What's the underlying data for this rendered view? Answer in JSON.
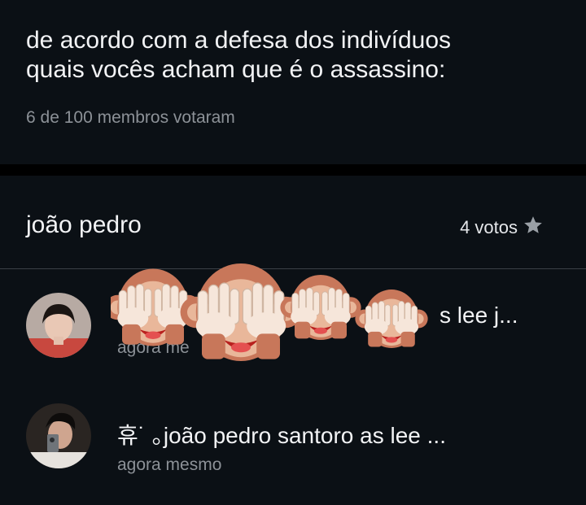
{
  "poll": {
    "question_line1": "de acordo com a defesa dos indivíduos",
    "question_line2": "quais vocês acham que é o assassino:",
    "votes_summary": "6 de 100 membros votaram"
  },
  "option": {
    "name": "joão pedro",
    "votes_label": "4 votos",
    "star_icon": "star-icon"
  },
  "voters": [
    {
      "name_visible": "s lee j...",
      "time": "agora me",
      "avatar_icon": "user-avatar"
    },
    {
      "name": "휴˙ ｡joão pedro santoro as lee ...",
      "time": "agora mesmo",
      "avatar_icon": "user-avatar"
    }
  ],
  "overlay": {
    "emoji": "see-no-evil-monkey-stickers",
    "count": 4
  },
  "colors": {
    "background": "#0b1015",
    "text_primary": "#f2f3f5",
    "text_secondary": "#8c9197",
    "divider": "#3b4046"
  }
}
